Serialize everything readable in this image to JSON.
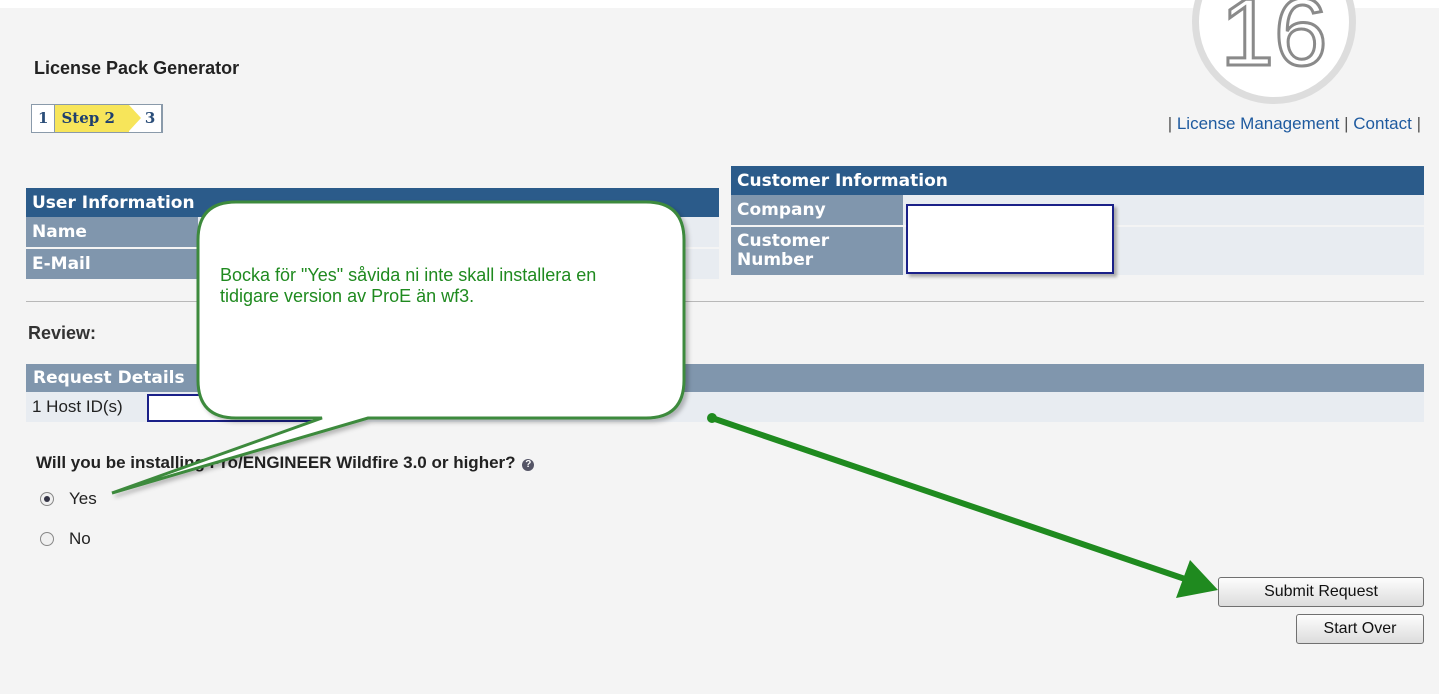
{
  "page": {
    "title": "License Pack Generator"
  },
  "steps": {
    "step1": "1",
    "step2": "Step 2",
    "step3": "3"
  },
  "topnav": {
    "pre": "| ",
    "license_management": "License Management",
    "sep": " | ",
    "contact": "Contact",
    "post": " |"
  },
  "badge": {
    "number": "16"
  },
  "user_info": {
    "header": "User Information",
    "name_label": "Name",
    "email_label": "E-Mail"
  },
  "customer_info": {
    "header": "Customer Information",
    "company_label": "Company",
    "customer_number_label": "Customer Number"
  },
  "review": {
    "label": "Review:"
  },
  "request_details": {
    "header": "Request Details",
    "host_ids": "1 Host ID(s)"
  },
  "question": {
    "text": "Will you be installing Pro/ENGINEER Wildfire 3.0 or higher?",
    "help_icon": "?"
  },
  "options": {
    "yes": "Yes",
    "no": "No",
    "selected": "Yes"
  },
  "buttons": {
    "submit": "Submit Request",
    "start_over": "Start Over"
  },
  "callout": {
    "text": "Bocka för \"Yes\" såvida ni inte skall installera en tidigare version av ProE än wf3."
  },
  "colors": {
    "header_dark": "#2b5b8a",
    "header_light": "#8096ad",
    "annotation_green": "#1f8a1f",
    "step_active": "#f7e55a"
  }
}
